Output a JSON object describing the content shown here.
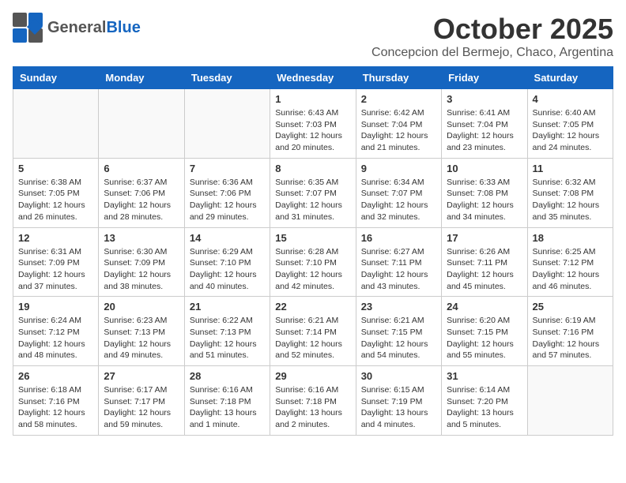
{
  "header": {
    "logo_general": "General",
    "logo_blue": "Blue",
    "month": "October 2025",
    "location": "Concepcion del Bermejo, Chaco, Argentina"
  },
  "days_of_week": [
    "Sunday",
    "Monday",
    "Tuesday",
    "Wednesday",
    "Thursday",
    "Friday",
    "Saturday"
  ],
  "weeks": [
    [
      {
        "day": "",
        "info": ""
      },
      {
        "day": "",
        "info": ""
      },
      {
        "day": "",
        "info": ""
      },
      {
        "day": "1",
        "info": "Sunrise: 6:43 AM\nSunset: 7:03 PM\nDaylight: 12 hours\nand 20 minutes."
      },
      {
        "day": "2",
        "info": "Sunrise: 6:42 AM\nSunset: 7:04 PM\nDaylight: 12 hours\nand 21 minutes."
      },
      {
        "day": "3",
        "info": "Sunrise: 6:41 AM\nSunset: 7:04 PM\nDaylight: 12 hours\nand 23 minutes."
      },
      {
        "day": "4",
        "info": "Sunrise: 6:40 AM\nSunset: 7:05 PM\nDaylight: 12 hours\nand 24 minutes."
      }
    ],
    [
      {
        "day": "5",
        "info": "Sunrise: 6:38 AM\nSunset: 7:05 PM\nDaylight: 12 hours\nand 26 minutes."
      },
      {
        "day": "6",
        "info": "Sunrise: 6:37 AM\nSunset: 7:06 PM\nDaylight: 12 hours\nand 28 minutes."
      },
      {
        "day": "7",
        "info": "Sunrise: 6:36 AM\nSunset: 7:06 PM\nDaylight: 12 hours\nand 29 minutes."
      },
      {
        "day": "8",
        "info": "Sunrise: 6:35 AM\nSunset: 7:07 PM\nDaylight: 12 hours\nand 31 minutes."
      },
      {
        "day": "9",
        "info": "Sunrise: 6:34 AM\nSunset: 7:07 PM\nDaylight: 12 hours\nand 32 minutes."
      },
      {
        "day": "10",
        "info": "Sunrise: 6:33 AM\nSunset: 7:08 PM\nDaylight: 12 hours\nand 34 minutes."
      },
      {
        "day": "11",
        "info": "Sunrise: 6:32 AM\nSunset: 7:08 PM\nDaylight: 12 hours\nand 35 minutes."
      }
    ],
    [
      {
        "day": "12",
        "info": "Sunrise: 6:31 AM\nSunset: 7:09 PM\nDaylight: 12 hours\nand 37 minutes."
      },
      {
        "day": "13",
        "info": "Sunrise: 6:30 AM\nSunset: 7:09 PM\nDaylight: 12 hours\nand 38 minutes."
      },
      {
        "day": "14",
        "info": "Sunrise: 6:29 AM\nSunset: 7:10 PM\nDaylight: 12 hours\nand 40 minutes."
      },
      {
        "day": "15",
        "info": "Sunrise: 6:28 AM\nSunset: 7:10 PM\nDaylight: 12 hours\nand 42 minutes."
      },
      {
        "day": "16",
        "info": "Sunrise: 6:27 AM\nSunset: 7:11 PM\nDaylight: 12 hours\nand 43 minutes."
      },
      {
        "day": "17",
        "info": "Sunrise: 6:26 AM\nSunset: 7:11 PM\nDaylight: 12 hours\nand 45 minutes."
      },
      {
        "day": "18",
        "info": "Sunrise: 6:25 AM\nSunset: 7:12 PM\nDaylight: 12 hours\nand 46 minutes."
      }
    ],
    [
      {
        "day": "19",
        "info": "Sunrise: 6:24 AM\nSunset: 7:12 PM\nDaylight: 12 hours\nand 48 minutes."
      },
      {
        "day": "20",
        "info": "Sunrise: 6:23 AM\nSunset: 7:13 PM\nDaylight: 12 hours\nand 49 minutes."
      },
      {
        "day": "21",
        "info": "Sunrise: 6:22 AM\nSunset: 7:13 PM\nDaylight: 12 hours\nand 51 minutes."
      },
      {
        "day": "22",
        "info": "Sunrise: 6:21 AM\nSunset: 7:14 PM\nDaylight: 12 hours\nand 52 minutes."
      },
      {
        "day": "23",
        "info": "Sunrise: 6:21 AM\nSunset: 7:15 PM\nDaylight: 12 hours\nand 54 minutes."
      },
      {
        "day": "24",
        "info": "Sunrise: 6:20 AM\nSunset: 7:15 PM\nDaylight: 12 hours\nand 55 minutes."
      },
      {
        "day": "25",
        "info": "Sunrise: 6:19 AM\nSunset: 7:16 PM\nDaylight: 12 hours\nand 57 minutes."
      }
    ],
    [
      {
        "day": "26",
        "info": "Sunrise: 6:18 AM\nSunset: 7:16 PM\nDaylight: 12 hours\nand 58 minutes."
      },
      {
        "day": "27",
        "info": "Sunrise: 6:17 AM\nSunset: 7:17 PM\nDaylight: 12 hours\nand 59 minutes."
      },
      {
        "day": "28",
        "info": "Sunrise: 6:16 AM\nSunset: 7:18 PM\nDaylight: 13 hours\nand 1 minute."
      },
      {
        "day": "29",
        "info": "Sunrise: 6:16 AM\nSunset: 7:18 PM\nDaylight: 13 hours\nand 2 minutes."
      },
      {
        "day": "30",
        "info": "Sunrise: 6:15 AM\nSunset: 7:19 PM\nDaylight: 13 hours\nand 4 minutes."
      },
      {
        "day": "31",
        "info": "Sunrise: 6:14 AM\nSunset: 7:20 PM\nDaylight: 13 hours\nand 5 minutes."
      },
      {
        "day": "",
        "info": ""
      }
    ]
  ]
}
